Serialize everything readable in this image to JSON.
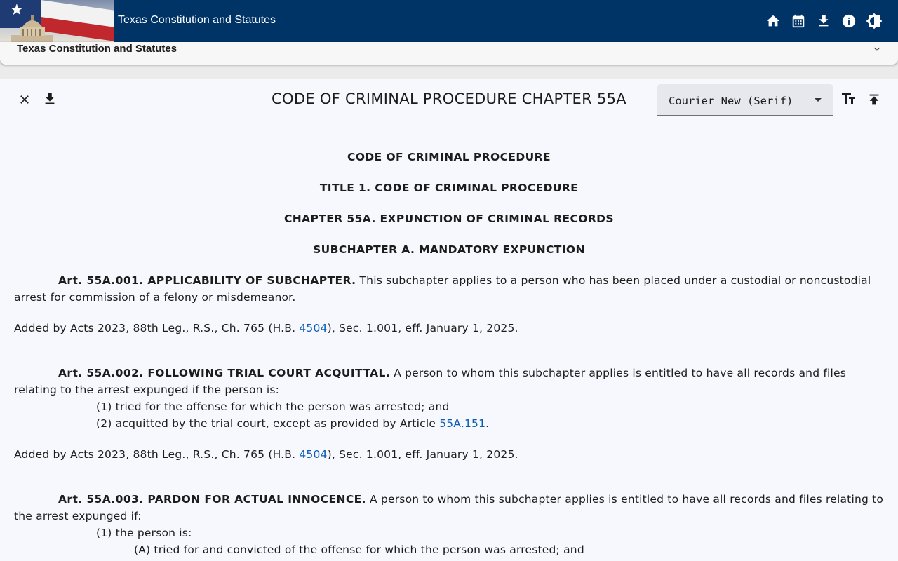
{
  "app": {
    "title": "Texas Constitution and Statutes",
    "icons": [
      "home-icon",
      "calendar-icon",
      "download-icon",
      "info-icon",
      "brightness-icon"
    ]
  },
  "panel": {
    "title": "Texas Constitution and Statutes"
  },
  "document": {
    "title": "CODE OF CRIMINAL PROCEDURE CHAPTER 55A",
    "font_select": "Courier New (Serif)",
    "headings": [
      "CODE OF CRIMINAL PROCEDURE",
      "TITLE 1. CODE OF CRIMINAL PROCEDURE",
      "CHAPTER 55A.  EXPUNCTION OF CRIMINAL RECORDS",
      "SUBCHAPTER A.  MANDATORY EXPUNCTION"
    ],
    "articles": [
      {
        "heading": "Art. 55A.001.  APPLICABILITY OF SUBCHAPTER.",
        "text": "  This subchapter applies to a person who has been placed under a custodial or noncustodial arrest for commission of a felony or misdemeanor.",
        "note_before": "Added by Acts 2023, 88th Leg., R.S., Ch. 765 (H.B. ",
        "note_link": "4504",
        "note_after": "), Sec. 1.001, eff. January 1, 2025."
      },
      {
        "heading": "Art. 55A.002.  FOLLOWING TRIAL COURT ACQUITTAL.",
        "text": "  A person to whom this subchapter applies is entitled to have all records and files relating to the arrest expunged if the person is:",
        "item1": "(1)  tried for the offense for which the person was arrested; and",
        "item2_before": "(2)  acquitted by the trial court, except as provided by Article ",
        "item2_link": "55A.151",
        "item2_after": ".",
        "note_before": "Added by Acts 2023, 88th Leg., R.S., Ch. 765 (H.B. ",
        "note_link": "4504",
        "note_after": "), Sec. 1.001, eff. January 1, 2025."
      },
      {
        "heading": "Art. 55A.003.  PARDON FOR ACTUAL INNOCENCE.",
        "text": "  A person to whom this subchapter applies is entitled to have all records and files relating to the arrest expunged if:",
        "item1": "(1)  the person is:",
        "itemA": "(A)  tried for and convicted of the offense for which the person was arrested; and"
      }
    ]
  }
}
